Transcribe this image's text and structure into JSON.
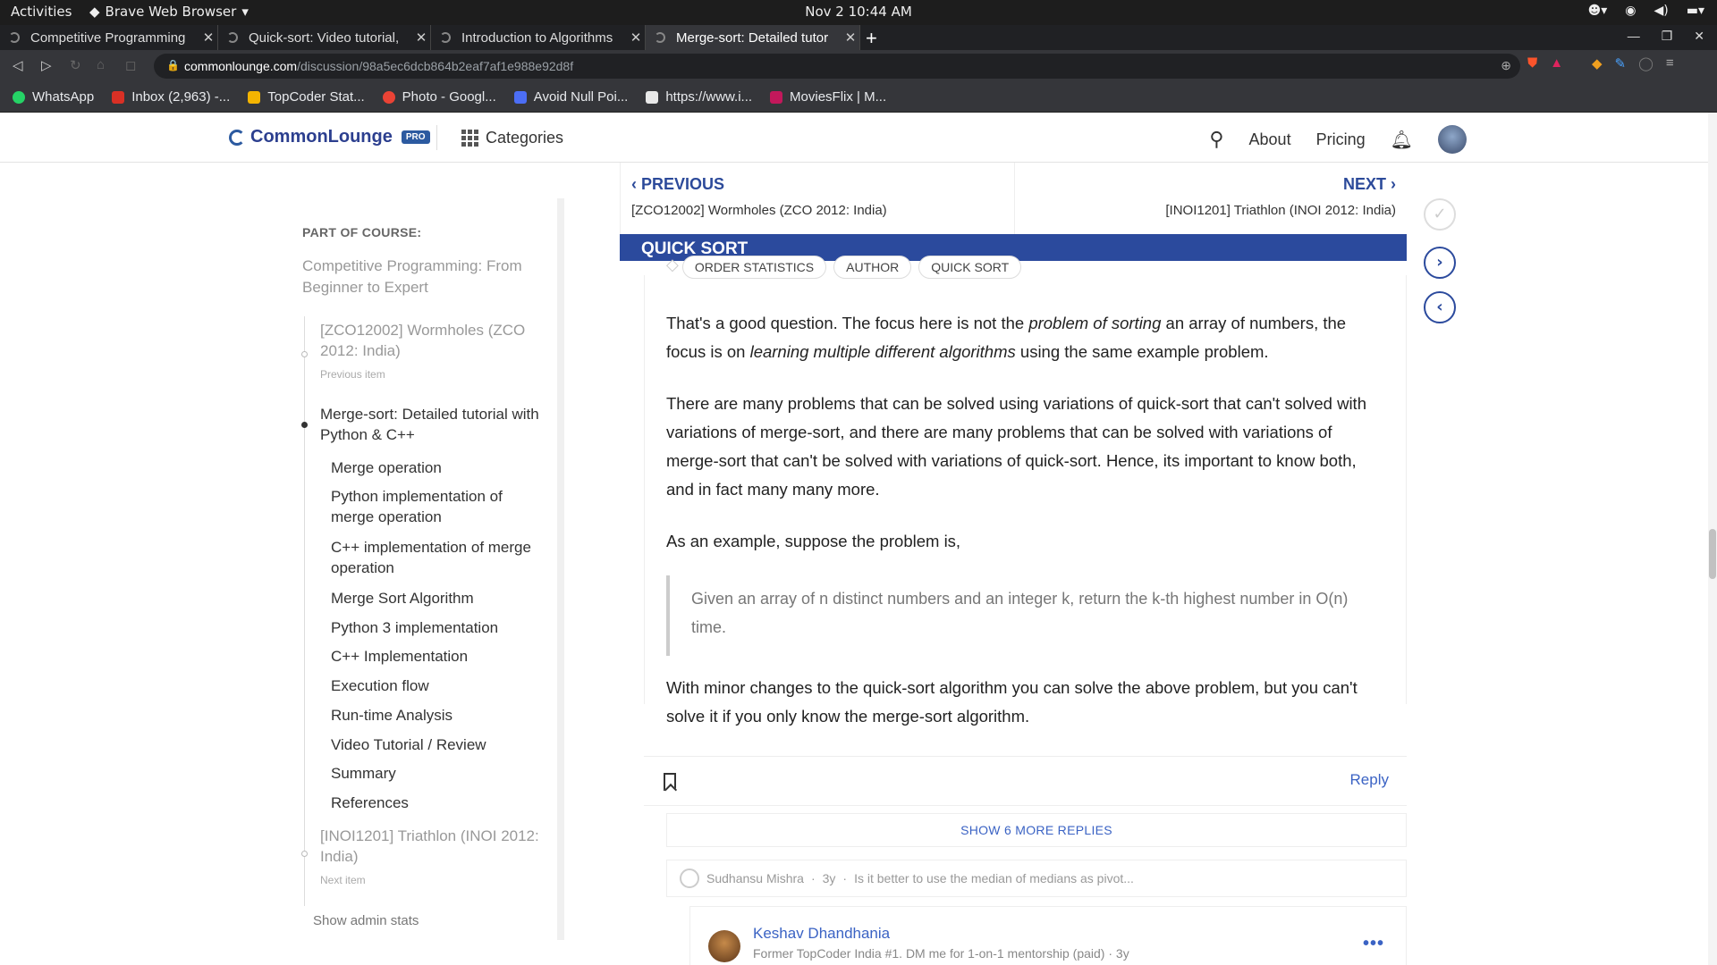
{
  "os": {
    "activities": "Activities",
    "app_name": "Brave Web Browser",
    "clock": "Nov 2  10:44 AM"
  },
  "tabs": [
    {
      "title": "Competitive Programming"
    },
    {
      "title": "Quick-sort: Video tutorial,"
    },
    {
      "title": "Introduction to Algorithms"
    },
    {
      "title": "Merge-sort: Detailed tutor",
      "active": true
    }
  ],
  "address": {
    "domain": "commonlounge.com",
    "path": "/discussion/98a5ec6dcb864b2eaf7af1e988e92d8f"
  },
  "bookmarks": [
    {
      "label": "WhatsApp",
      "color": "#25d366"
    },
    {
      "label": "Inbox (2,963) -...",
      "color": "#d93025"
    },
    {
      "label": "TopCoder Stat...",
      "color": "#f4b400"
    },
    {
      "label": "Photo - Googl...",
      "color": "#ea4335"
    },
    {
      "label": "Avoid Null Poi...",
      "color": "#4c6ef5"
    },
    {
      "label": "https://www.i...",
      "color": "#e8e8e8"
    },
    {
      "label": "MoviesFlix | M...",
      "color": "#c2185b"
    }
  ],
  "site": {
    "logo": "CommonLounge",
    "pro_badge": "PRO",
    "categories": "Categories",
    "about": "About",
    "pricing": "Pricing"
  },
  "sidebar": {
    "part_of_course": "PART OF COURSE:",
    "course_title": "Competitive Programming: From Beginner to Expert",
    "prev_item": "[ZCO12002] Wormholes (ZCO 2012: India)",
    "prev_label": "Previous item",
    "current_item": "Merge-sort: Detailed tutorial with Python & C++",
    "sections": [
      "Merge operation",
      "Python implementation of merge operation",
      "C++ implementation of merge operation",
      "Merge Sort Algorithm",
      "Python 3 implementation",
      "C++ Implementation",
      "Execution flow",
      "Run-time Analysis",
      "Video Tutorial / Review",
      "Summary",
      "References"
    ],
    "next_item": "[INOI1201] Triathlon (INOI 2012: India)",
    "next_label": "Next item",
    "admin": "Show admin stats"
  },
  "nav": {
    "previous_label": "PREVIOUS",
    "previous_title": "[ZCO12002] Wormholes (ZCO 2012: India)",
    "next_label": "NEXT",
    "next_title": "[INOI1201] Triathlon (INOI 2012: India)"
  },
  "section_title": "QUICK SORT",
  "tags": [
    "ORDER STATISTICS",
    "AUTHOR",
    "QUICK SORT"
  ],
  "post": {
    "p1_a": "That's a good question. The focus here is not the ",
    "p1_em1": "problem of sorting",
    "p1_b": " an array of numbers, the focus is on ",
    "p1_em2": "learning multiple different algorithms",
    "p1_c": " using the same example problem.",
    "p2": "There are many problems that can be solved using variations of quick-sort that can't solved with variations of merge-sort, and there are many problems that can be solved with variations of merge-sort that can't be solved with variations of quick-sort. Hence, its important to know both, and in fact many many more.",
    "p3": "As an example, suppose the problem is,",
    "quote": "Given an array of n distinct numbers and an integer k, return the k-th highest number in O(n) time.",
    "p4": "With minor changes to the quick-sort algorithm you can solve the above problem, but you can't solve it if you only know the merge-sort algorithm.",
    "reply": "Reply"
  },
  "thread": {
    "show_more": "SHOW 6 MORE REPLIES",
    "collapsed_author": "Sudhansu Mishra",
    "collapsed_age": "3y",
    "collapsed_snippet": "Is it better to use the median of medians as pivot...",
    "reply_author": "Keshav Dhandhania",
    "reply_meta": "Former TopCoder India #1. DM me for 1-on-1 mentorship (paid) · 3y"
  }
}
